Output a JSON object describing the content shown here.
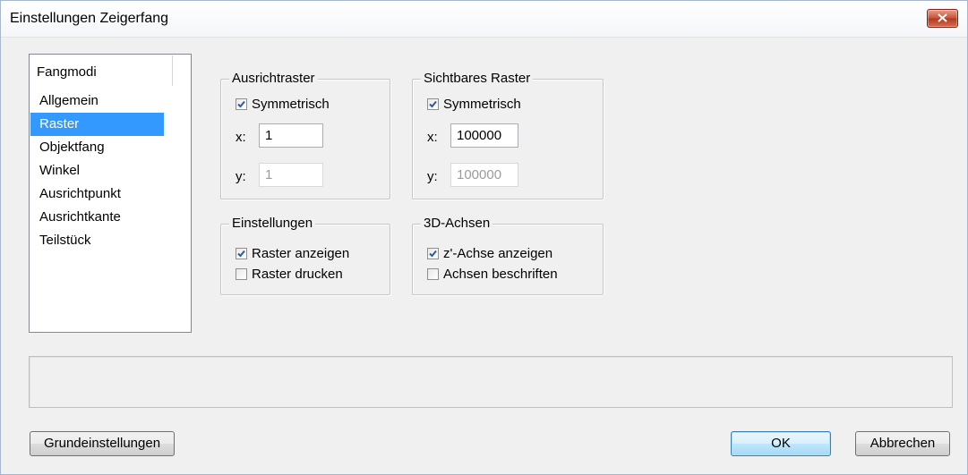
{
  "window": {
    "title": "Einstellungen Zeigerfang"
  },
  "modes": {
    "header": "Fangmodi",
    "items": [
      "Allgemein",
      "Raster",
      "Objektfang",
      "Winkel",
      "Ausrichtpunkt",
      "Ausrichtkante",
      "Teilstück"
    ],
    "selected": "Raster"
  },
  "ausrichtraster": {
    "legend": "Ausrichtraster",
    "symmetric_label": "Symmetrisch",
    "symmetric_checked": true,
    "x_label": "x:",
    "x_value": "1",
    "y_label": "y:",
    "y_value": "1"
  },
  "sichtbares_raster": {
    "legend": "Sichtbares Raster",
    "symmetric_label": "Symmetrisch",
    "symmetric_checked": true,
    "x_label": "x:",
    "x_value": "100000",
    "y_label": "y:",
    "y_value": "100000"
  },
  "einstellungen": {
    "legend": "Einstellungen",
    "show_grid_label": "Raster anzeigen",
    "show_grid_checked": true,
    "print_grid_label": "Raster drucken",
    "print_grid_checked": false
  },
  "achsen3d": {
    "legend": "3D-Achsen",
    "show_z_label": "z'-Achse anzeigen",
    "show_z_checked": true,
    "label_axes_label": "Achsen beschriften",
    "label_axes_checked": false
  },
  "buttons": {
    "defaults": "Grundeinstellungen",
    "ok": "OK",
    "cancel": "Abbrechen"
  },
  "colors": {
    "selection": "#3399ff",
    "close_button": "#c85036"
  }
}
